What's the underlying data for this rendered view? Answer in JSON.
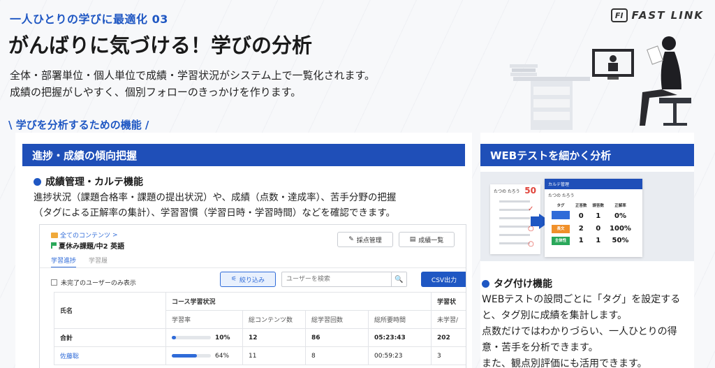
{
  "header": {
    "series_label": "一人ひとりの学びに最適化 03",
    "title": "がんばりに気づける！学びの分析",
    "desc_line1": "全体・部署単位・個人単位で成績・学習状況がシステム上で一覧化されます。",
    "desc_line2": "成績の把握がしやすく、個別フォローのきっかけを作ります。",
    "section": "\\ 学びを分析するための機能 /"
  },
  "logo": {
    "mark": "Fl",
    "name": "FAST LINK"
  },
  "left_panel": {
    "heading": "進捗・成績の傾向把握",
    "feature_title": "成績管理・カルテ機能",
    "feature_line1": "進捗状況（課題合格率・課題の提出状況）や、成績（点数・達成率）、苦手分野の把握",
    "feature_line2": "（タグによる正解率の集計）、学習習慣（学習日時・学習時間）などを確認できます。"
  },
  "app": {
    "breadcrumb": "全てのコンテンツ",
    "breadcrumb_sep": ">",
    "course": "夏休み課題/中2 英語",
    "btn_grading": "採点管理",
    "btn_grades": "成績一覧",
    "tab_progress": "学習進捗",
    "tab_history": "学習履",
    "checkbox_label": "未完了のユーザーのみ表示",
    "filter_label": "絞り込み",
    "search_placeholder": "ユーザーを検索",
    "search_icon": "🔍",
    "csv_label": "CSV出力",
    "table": {
      "col_name": "氏名",
      "group_course": "コース学習状況",
      "group_study": "学習状",
      "headers": [
        "学習率",
        "総コンテンツ数",
        "総学習回数",
        "総所要時間",
        "未学習/"
      ],
      "rows": [
        {
          "name": "合計",
          "rate_text": "10%",
          "rate": 10,
          "contents": "12",
          "count": "86",
          "time": "05:23:43",
          "unlearned": "202"
        },
        {
          "name": "佐藤聡",
          "rate_text": "64%",
          "rate": 64,
          "contents": "11",
          "count": "8",
          "time": "00:59:23",
          "unlearned": "3"
        }
      ]
    }
  },
  "right_panel": {
    "heading": "WEBテストを細かく分析",
    "feature_title": "タグ付け機能",
    "line1": "WEBテストの設問ごとに「タグ」を設定すると、タグ別に成績を集計します。",
    "line2": "点数だけではわかりづらい、一人ひとりの得意・苦手を分析できます。",
    "line3": "また、観点別評価にも活用できます。",
    "karte": {
      "head": "カルテ管理",
      "name": "たつの たろう",
      "paper_name": "たつの たろう",
      "paper_score": "50",
      "cols": [
        "タグ",
        "正答数",
        "誤答数",
        "正解率"
      ],
      "rows": [
        {
          "tag": "",
          "tag_color": "#2f6bd8",
          "correct": "0",
          "wrong": "1",
          "rate": "0%"
        },
        {
          "tag": "長文",
          "tag_color": "#f0902a",
          "correct": "2",
          "wrong": "0",
          "rate": "100%"
        },
        {
          "tag": "主体性",
          "tag_color": "#2aa85a",
          "correct": "1",
          "wrong": "1",
          "rate": "50%"
        }
      ]
    }
  },
  "colors": {
    "accent": "#1f57c3",
    "bar": "#1f4fb8"
  }
}
